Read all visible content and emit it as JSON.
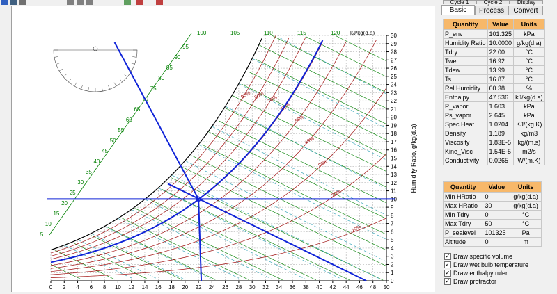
{
  "tabs_top": [
    "Cycle 1",
    "Cycle 2",
    "Display"
  ],
  "tabs_bottom": [
    "Basic",
    "Process",
    "Convert"
  ],
  "headers": {
    "q": "Quantity",
    "v": "Value",
    "u": "Units"
  },
  "props": [
    {
      "q": "P_env",
      "v": "101.325",
      "u": "kPa"
    },
    {
      "q": "Humidity Ratio",
      "v": "10.0000",
      "u": "g/kg(d.a)"
    },
    {
      "q": "Tdry",
      "v": "22.00",
      "u": "°C"
    },
    {
      "q": "Twet",
      "v": "16.92",
      "u": "°C"
    },
    {
      "q": "Tdew",
      "v": "13.99",
      "u": "°C"
    },
    {
      "q": "Ts",
      "v": "16.87",
      "u": "°C"
    },
    {
      "q": "Rel.Humidity",
      "v": "60.38",
      "u": "%"
    },
    {
      "q": "Enthalpy",
      "v": "47.536",
      "u": "kJ/kg(d.a)"
    },
    {
      "q": "P_vapor",
      "v": "1.603",
      "u": "kPa"
    },
    {
      "q": "Ps_vapor",
      "v": "2.645",
      "u": "kPa"
    },
    {
      "q": "Spec.Heat",
      "v": "1.0204",
      "u": "KJ/(kg.K)"
    },
    {
      "q": "Density",
      "v": "1.189",
      "u": "kg/m3"
    },
    {
      "q": "Viscosity",
      "v": "1.83E-5",
      "u": "kg/(m.s)"
    },
    {
      "q": "Kine_Visc",
      "v": "1.54E-5",
      "u": "m2/s"
    },
    {
      "q": "Conductivity",
      "v": "0.0265",
      "u": "W/(m.K)"
    }
  ],
  "limits": [
    {
      "q": "Min HRatio",
      "v": "0",
      "u": "g/kg(d.a)"
    },
    {
      "q": "Max HRatio",
      "v": "30",
      "u": "g/kg(d.a)"
    },
    {
      "q": "Min Tdry",
      "v": "0",
      "u": "°C"
    },
    {
      "q": "Max Tdry",
      "v": "50",
      "u": "°C"
    },
    {
      "q": "P_sealevel",
      "v": "101325",
      "u": "Pa"
    },
    {
      "q": "Altitude",
      "v": "0",
      "u": "m"
    }
  ],
  "checks": [
    {
      "label": "Draw specific volume",
      "checked": true
    },
    {
      "label": "Draw wet bulb temperature",
      "checked": true
    },
    {
      "label": "Draw enthalpy ruler",
      "checked": true
    },
    {
      "label": "Draw protractor",
      "checked": true
    }
  ],
  "chart": {
    "y_axis_label": "Humidity Ratio, g/kg(d.a)",
    "enthalpy_unit": "kJ/kg(d.a)",
    "x_ticks": [
      "0",
      "2",
      "4",
      "6",
      "8",
      "10",
      "12",
      "14",
      "16",
      "18",
      "20",
      "22",
      "24",
      "26",
      "28",
      "30",
      "32",
      "34",
      "36",
      "38",
      "40",
      "42",
      "44",
      "46",
      "48",
      "50"
    ],
    "y_ticks": [
      "0",
      "1",
      "2",
      "3",
      "4",
      "5",
      "6",
      "7",
      "8",
      "9",
      "10",
      "11",
      "12",
      "13",
      "14",
      "15",
      "16",
      "17",
      "18",
      "19",
      "20",
      "21",
      "22",
      "23",
      "24",
      "25",
      "26",
      "27",
      "28",
      "29",
      "30"
    ],
    "top_enthalpy": [
      "100",
      "105",
      "110",
      "115",
      "120"
    ],
    "left_enthalpy": [
      "95",
      "90",
      "85",
      "80",
      "75",
      "70",
      "65",
      "60",
      "55",
      "50",
      "45",
      "40",
      "35",
      "30",
      "25",
      "20",
      "15",
      "10",
      "5"
    ],
    "rh_labels": [
      "90%",
      "80%",
      "70%",
      "60%",
      "50%",
      "40%",
      "30%",
      "20%",
      "10%"
    ],
    "state": {
      "tdry": 22,
      "w": 10
    },
    "colors": {
      "grid": "#a0a0a0",
      "rh": "#a01010",
      "enthalpy": "#008000",
      "wetbulb": "#3aa6b9",
      "volume": "#2f8fa0",
      "marker": "#1024d8"
    }
  }
}
